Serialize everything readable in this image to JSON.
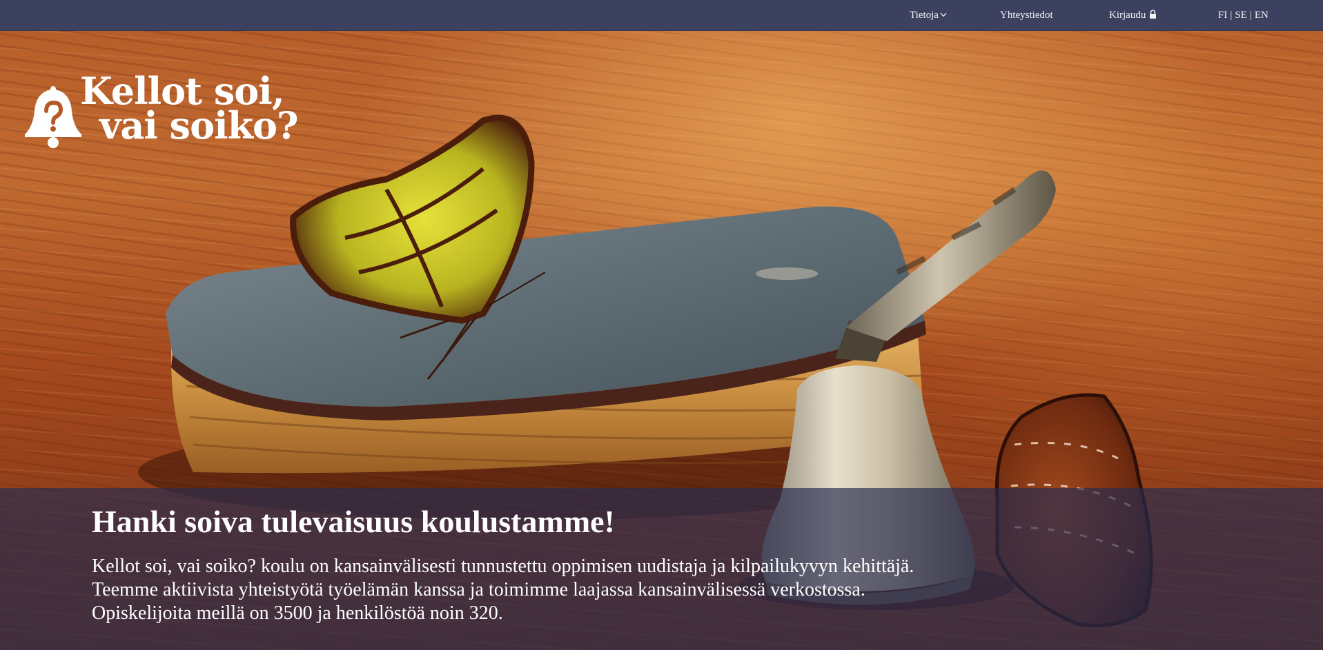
{
  "nav": {
    "tietoja": "Tietoja",
    "yhteystiedot": "Yhteystiedot",
    "kirjaudu": "Kirjaudu",
    "languages": [
      "FI",
      "SE",
      "EN"
    ],
    "separator": "|"
  },
  "logo": {
    "line1": "Kellot soi,",
    "line2": "vai soiko?",
    "icon": "bell-question-icon"
  },
  "hero": {
    "heading": "Hanki soiva tulevaisuus koulustamme!",
    "lines": [
      "Kellot soi, vai soiko? koulu on kansainvälisesti tunnustettu oppimisen uudistaja ja kilpailukyvyn kehittäjä.",
      "Teemme aktiivista yhteistyötä työelämän kanssa ja toimimme laajassa kansainvälisessä verkostossa.",
      "Opiskelijoita meillä on 3500 ja henkilöstöä noin 320."
    ]
  },
  "colors": {
    "topbar": "#3c4160",
    "caption_overlay": "rgba(40,44,80,0.68)",
    "text": "#ffffff"
  }
}
